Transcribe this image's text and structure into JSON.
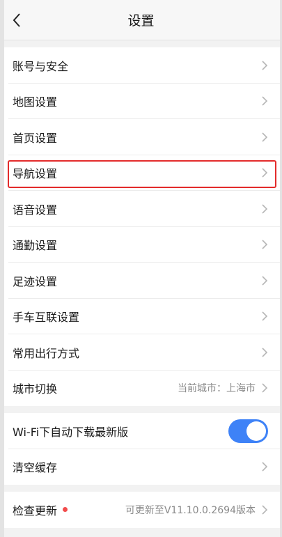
{
  "header": {
    "title": "设置"
  },
  "group1": [
    {
      "id": "account",
      "label": "账号与安全"
    },
    {
      "id": "map",
      "label": "地图设置"
    },
    {
      "id": "home",
      "label": "首页设置"
    },
    {
      "id": "navigation",
      "label": "导航设置"
    },
    {
      "id": "voice",
      "label": "语音设置"
    },
    {
      "id": "commute",
      "label": "通勤设置"
    },
    {
      "id": "footprint",
      "label": "足迹设置"
    },
    {
      "id": "car-link",
      "label": "手车互联设置"
    },
    {
      "id": "travel-mode",
      "label": "常用出行方式"
    },
    {
      "id": "city",
      "label": "城市切换",
      "value": "当前城市：上海市"
    }
  ],
  "group2": {
    "wifi_download": {
      "label": "Wi-Fi下自动下载最新版",
      "enabled": true
    },
    "clear_cache": {
      "label": "清空缓存"
    }
  },
  "group3": {
    "check_update": {
      "label": "检查更新",
      "value": "可更新至V11.10.0.2694版本"
    }
  },
  "colors": {
    "accent": "#3e82f7",
    "highlight": "#e32b2b",
    "dot": "#f24c4c"
  }
}
